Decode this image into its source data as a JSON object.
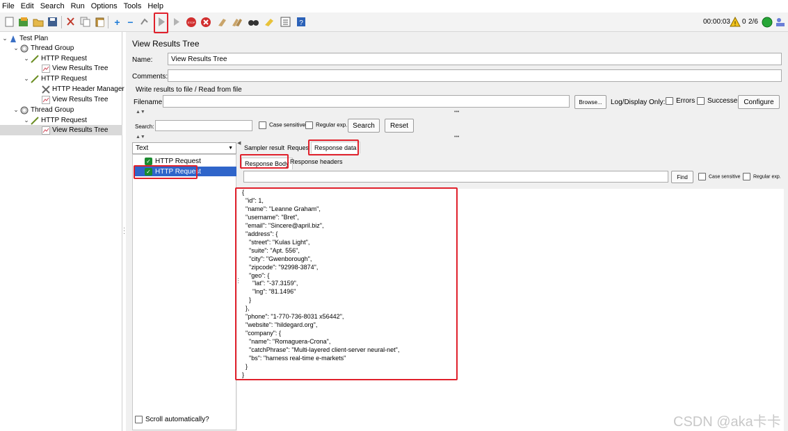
{
  "menu": [
    "File",
    "Edit",
    "Search",
    "Run",
    "Options",
    "Tools",
    "Help"
  ],
  "toolbar": {
    "timer": "00:00:03",
    "warning_count": "0",
    "threads": "2/6"
  },
  "tree": {
    "items": [
      {
        "label": "Test Plan",
        "icon": "test-plan-icon"
      },
      {
        "label": "Thread Group",
        "icon": "thread-group-icon"
      },
      {
        "label": "HTTP Request",
        "icon": "sampler-icon"
      },
      {
        "label": "View Results Tree",
        "icon": "listener-icon"
      },
      {
        "label": "HTTP Request",
        "icon": "sampler-icon"
      },
      {
        "label": "HTTP Header Manager",
        "icon": "config-icon"
      },
      {
        "label": "View Results Tree",
        "icon": "listener-icon"
      },
      {
        "label": "Thread Group",
        "icon": "thread-group-icon"
      },
      {
        "label": "HTTP Request",
        "icon": "sampler-icon"
      },
      {
        "label": "View Results Tree",
        "icon": "listener-icon"
      }
    ]
  },
  "panel": {
    "title": "View Results Tree",
    "name_label": "Name:",
    "name_value": "View Results Tree",
    "comments_label": "Comments:",
    "comments_value": "",
    "write_results_label": "Write results to file / Read from file",
    "filename_label": "Filename",
    "filename_value": "",
    "browse_button": "Browse...",
    "log_display_label": "Log/Display Only:",
    "errors_label": "Errors",
    "successes_label": "Successes",
    "configure_button": "Configure"
  },
  "search": {
    "label": "Search:",
    "value": "",
    "case_sensitive": "Case sensitive",
    "regular_exp": "Regular exp.",
    "search_button": "Search",
    "reset_button": "Reset"
  },
  "results": {
    "renderer": "Text",
    "items": [
      "HTTP Request",
      "HTTP Request"
    ],
    "scroll_automatically": "Scroll automatically?"
  },
  "tabs": {
    "sampler_result": "Sampler result",
    "request": "Request",
    "response_data": "Response data",
    "response_body": "Response Body",
    "response_headers": "Response headers"
  },
  "find": {
    "value": "",
    "find_button": "Find",
    "case_sensitive": "Case sensitive",
    "regular_exp": "Regular exp."
  },
  "response_body": "{\n  \"id\": 1,\n  \"name\": \"Leanne Graham\",\n  \"username\": \"Bret\",\n  \"email\": \"Sincere@april.biz\",\n  \"address\": {\n    \"street\": \"Kulas Light\",\n    \"suite\": \"Apt. 556\",\n    \"city\": \"Gwenborough\",\n    \"zipcode\": \"92998-3874\",\n    \"geo\": {\n      \"lat\": \"-37.3159\",\n      \"lng\": \"81.1496\"\n    }\n  },\n  \"phone\": \"1-770-736-8031 x56442\",\n  \"website\": \"hildegard.org\",\n  \"company\": {\n    \"name\": \"Romaguera-Crona\",\n    \"catchPhrase\": \"Multi-layered client-server neural-net\",\n    \"bs\": \"harness real-time e-markets\"\n  }\n}",
  "watermark": "CSDN @aka卡卡"
}
